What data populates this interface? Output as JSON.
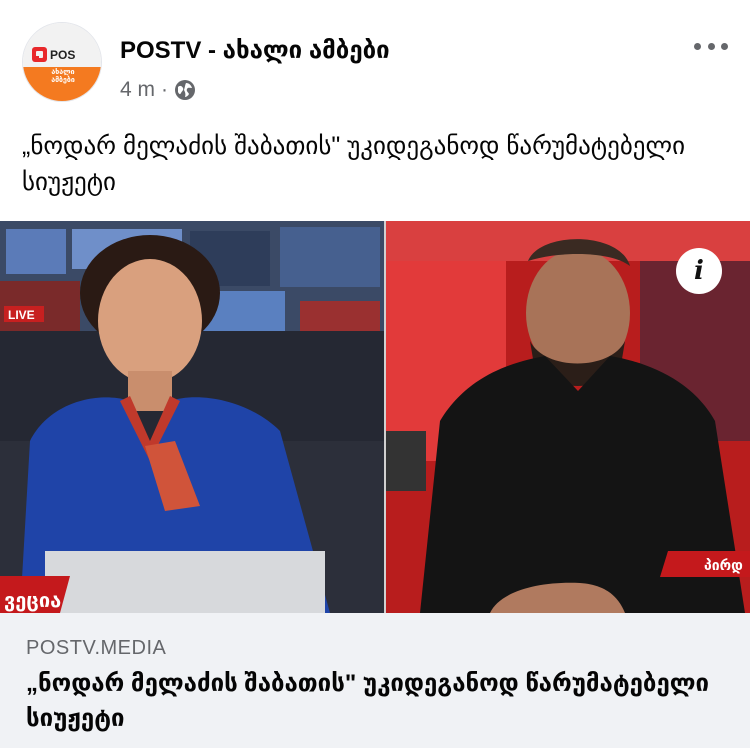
{
  "post": {
    "page_name": "POSTV - ახალი ამბები",
    "time": "4 m",
    "separator": "·",
    "privacy_icon": "globe-icon",
    "more_icon": "more-horizontal-icon",
    "text": "„ნოდარ მელაძის შაბათის\" უკიდეგანოდ წარუმატებელი სიუჟეტი"
  },
  "avatar": {
    "logo_text": "POS",
    "sub_text": "ახალი ამბები",
    "brand_color": "#f47a20"
  },
  "media": {
    "info_icon": "info-icon",
    "info_glyph": "i",
    "left_overlay": "LIVE",
    "left_ticker": "ვეცია",
    "right_ticker": "პირდ"
  },
  "link": {
    "domain": "POSTV.MEDIA",
    "title": "„ნოდარ მელაძის შაბათის\" უკიდეგანოდ წარუმატებელი სიუჟეტი"
  },
  "colors": {
    "text_primary": "#050505",
    "text_secondary": "#65676b",
    "card_bg": "#f0f2f5",
    "news_red": "#d81c1c"
  }
}
